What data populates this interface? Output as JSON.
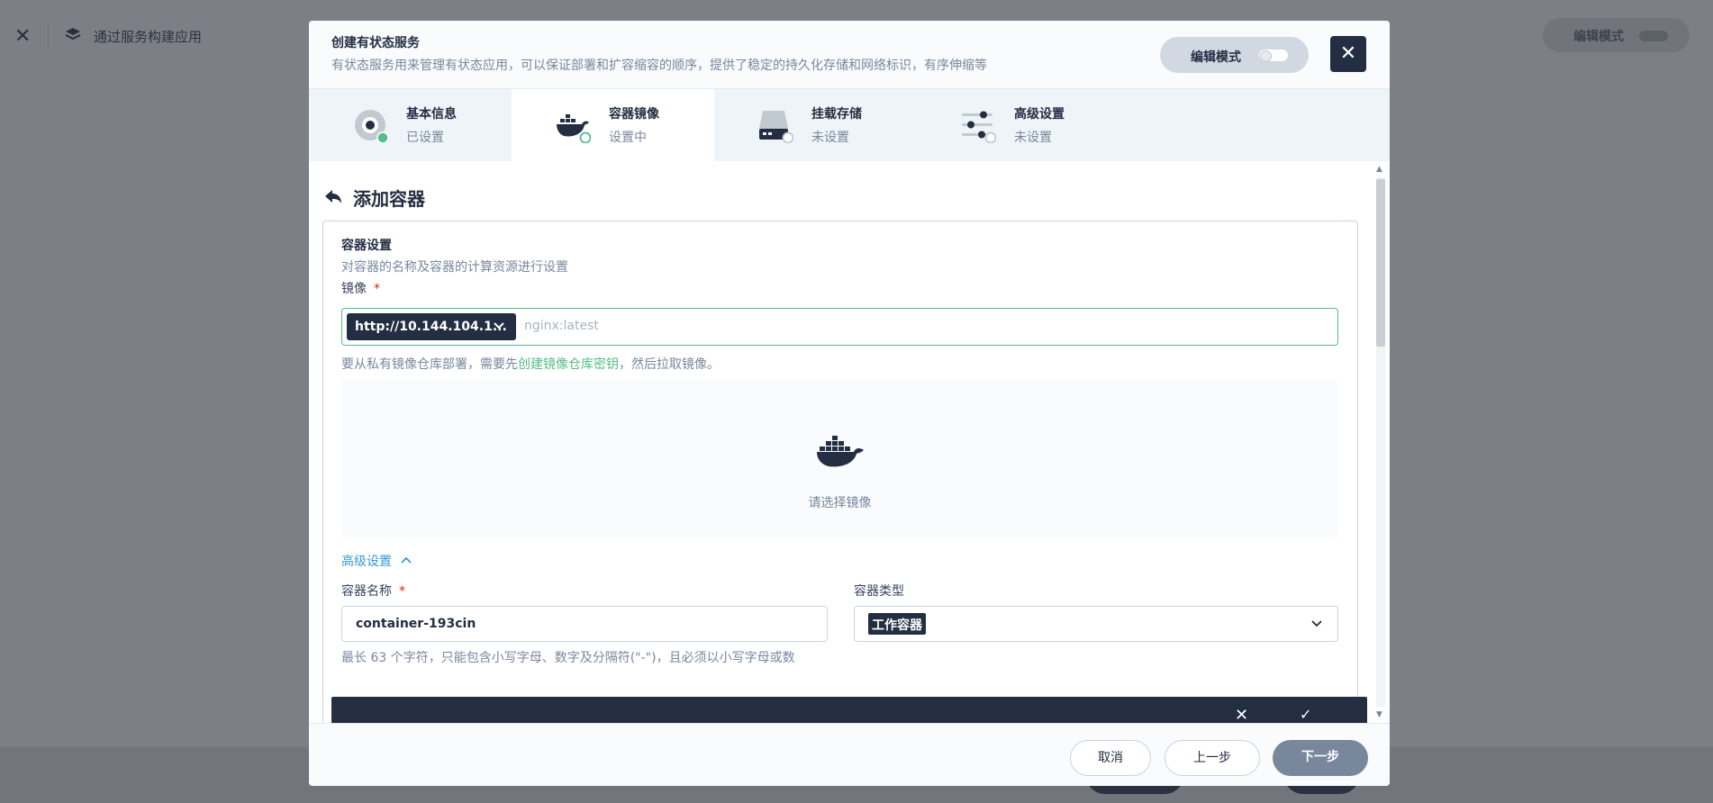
{
  "background": {
    "title": "通过服务构建应用",
    "edit_mode_label": "编辑模式"
  },
  "modal": {
    "title": "创建有状态服务",
    "description": "有状态服务用来管理有状态应用，可以保证部署和扩容缩容的顺序，提供了稳定的持久化存储和网络标识，有序伸缩等",
    "edit_mode_label": "编辑模式"
  },
  "steps": [
    {
      "name": "基本信息",
      "status": "已设置"
    },
    {
      "name": "容器镜像",
      "status": "设置中"
    },
    {
      "name": "挂载存储",
      "status": "未设置"
    },
    {
      "name": "高级设置",
      "status": "未设置"
    }
  ],
  "section": {
    "title": "添加容器",
    "card_title": "容器设置",
    "card_desc": "对容器的名称及容器的计算资源进行设置",
    "image_label": "镜像",
    "required_mark": "*",
    "repo_value": "http://10.144.104.1...",
    "image_placeholder": "nginx:latest",
    "hint_prefix": "要从私有镜像仓库部署，需要先",
    "hint_link": "创建镜像仓库密钥",
    "hint_suffix": "，然后拉取镜像。",
    "empty_text": "请选择镜像",
    "advanced_label": "高级设置",
    "container_name_label": "容器名称",
    "container_name_value": "container-193cin",
    "container_type_label": "容器类型",
    "container_type_value": "工作容器",
    "name_hint": "最长 63 个字符，只能包含小写字母、数字及分隔符(\"-\")，且必须以小写字母或数"
  },
  "footer": {
    "cancel": "取消",
    "prev": "上一步",
    "next": "下一步"
  }
}
